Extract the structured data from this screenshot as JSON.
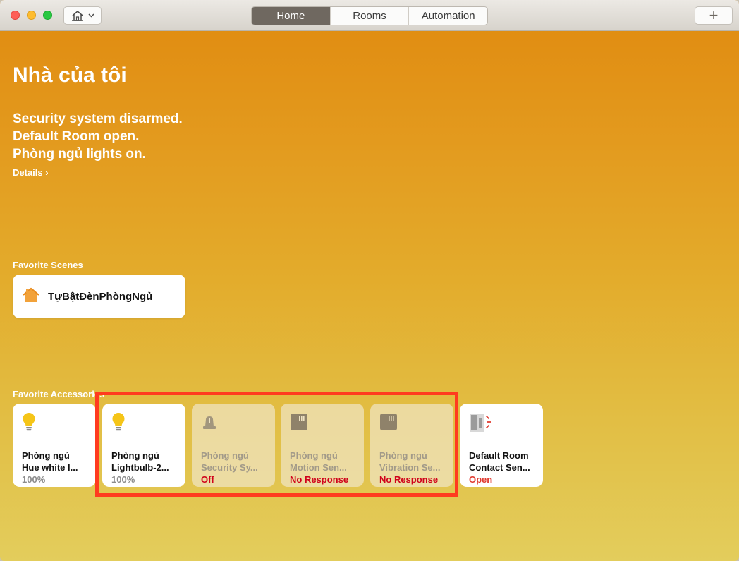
{
  "titlebar": {
    "tabs": [
      {
        "label": "Home",
        "active": true
      },
      {
        "label": "Rooms",
        "active": false
      },
      {
        "label": "Automation",
        "active": false
      }
    ],
    "add_label": "+"
  },
  "header": {
    "title": "Nhà của tôi",
    "summary": [
      "Security system disarmed.",
      "Default Room open.",
      "Phòng ngủ lights on."
    ],
    "details_label": "Details ›"
  },
  "favorite_scenes": {
    "label": "Favorite Scenes",
    "items": [
      {
        "name": "TựBậtĐènPhòngNgủ",
        "icon": "home-icon"
      }
    ]
  },
  "favorite_accessories": {
    "label": "Favorite Accessories",
    "items": [
      {
        "line1": "Phòng ngủ",
        "line2": "Hue white l...",
        "status": "100%",
        "icon": "lightbulb-icon",
        "dim": false
      },
      {
        "line1": "Phòng ngủ",
        "line2": "Lightbulb-2...",
        "status": "100%",
        "icon": "lightbulb-icon",
        "dim": false
      },
      {
        "line1": "Phòng ngủ",
        "line2": "Security Sy...",
        "status": "Off",
        "icon": "security-alarm-icon",
        "dim": true
      },
      {
        "line1": "Phòng ngủ",
        "line2": "Motion Sen...",
        "status": "No Response",
        "icon": "sensor-icon",
        "dim": true
      },
      {
        "line1": "Phòng ngủ",
        "line2": "Vibration Se...",
        "status": "No Response",
        "icon": "sensor-icon",
        "dim": true
      },
      {
        "line1": "Default Room",
        "line2": "Contact Sen...",
        "status": "Open",
        "icon": "contact-sensor-icon",
        "dim": false
      }
    ]
  },
  "colors": {
    "background_top": "#e08a0f",
    "background_bottom": "#e3cd5c",
    "highlight_box": "#ff3b1f",
    "no_response_red": "#d0021b",
    "active_tab": "#6f6860"
  }
}
